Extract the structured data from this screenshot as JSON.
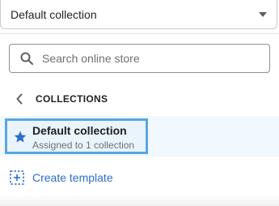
{
  "template_select": {
    "selected": "Default collection"
  },
  "search": {
    "placeholder": "Search online store",
    "value": ""
  },
  "collections": {
    "title": "COLLECTIONS"
  },
  "selected_item": {
    "title": "Default collection",
    "subtitle": "Assigned to 1 collection",
    "icon": "star-icon"
  },
  "create_template": {
    "label": "Create template",
    "icon": "add-icon"
  },
  "colors": {
    "accent": "#2c6ecb",
    "selection_border": "#5aa6e0",
    "selection_bg": "#eaf4fc"
  }
}
